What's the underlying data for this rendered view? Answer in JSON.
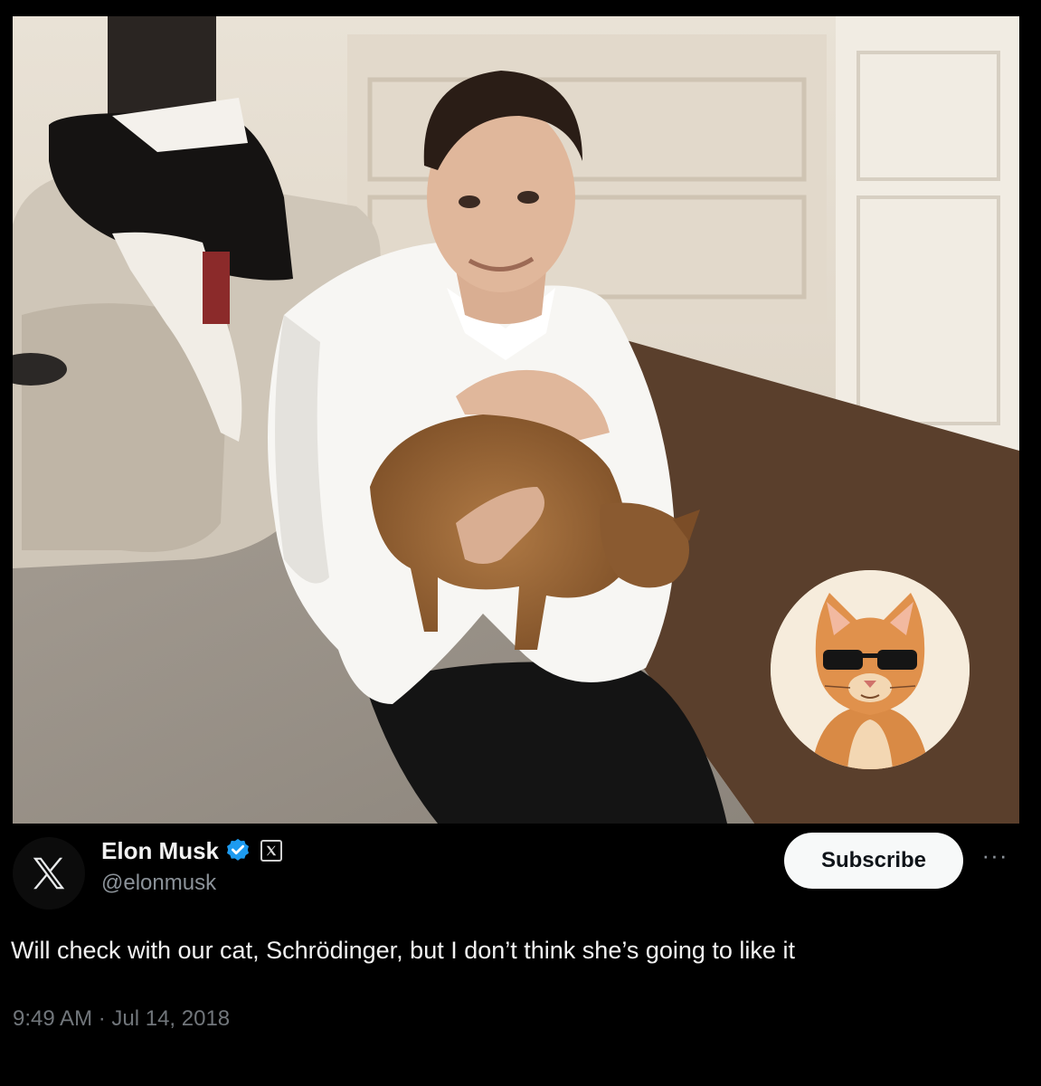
{
  "post": {
    "author": {
      "display_name": "Elon Musk",
      "handle": "@elonmusk",
      "verified_icon": "verified-badge-icon",
      "affiliation_icon": "x-logo-icon"
    },
    "subscribe_label": "Subscribe",
    "more_label": "···",
    "text": "Will check with our cat, Schrödinger, but I don’t think she’s going to like it",
    "timestamp": "9:49 AM · Jul 14, 2018"
  },
  "colors": {
    "background": "#000000",
    "verified_blue": "#1d9bf0",
    "text_primary": "#f2f2f2",
    "text_secondary": "#8b9299",
    "subscribe_bg": "#f7f9f9"
  }
}
